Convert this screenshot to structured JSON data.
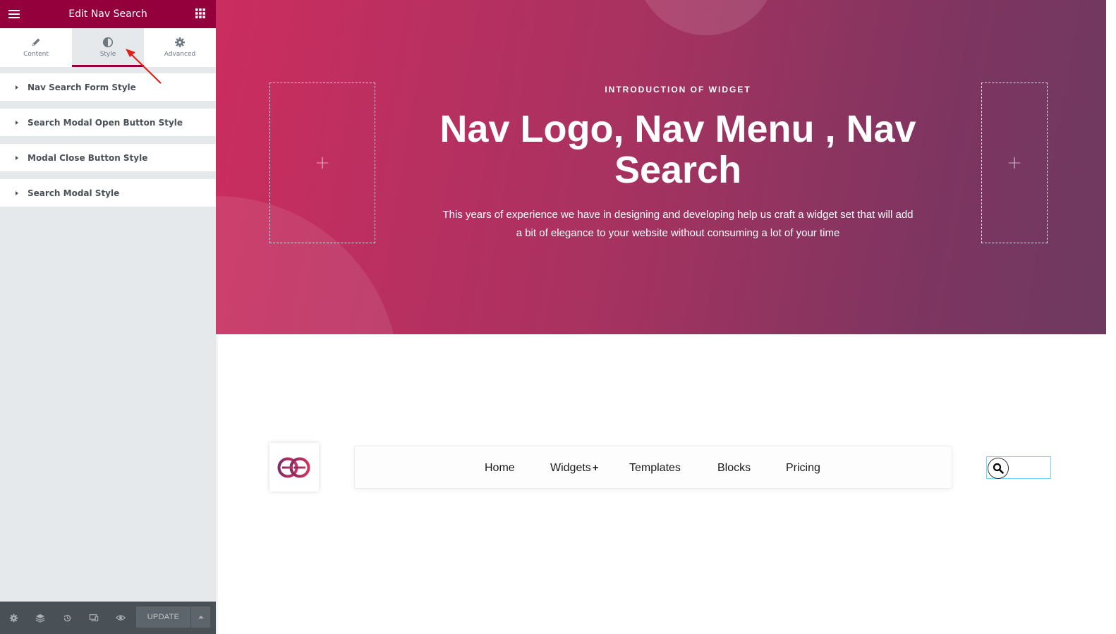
{
  "panel": {
    "title": "Edit Nav Search",
    "tabs": [
      {
        "label": "Content",
        "icon": "pencil-icon"
      },
      {
        "label": "Style",
        "icon": "half-circle-icon",
        "active": true
      },
      {
        "label": "Advanced",
        "icon": "gear-icon"
      }
    ],
    "sections": [
      {
        "label": "Nav Search Form Style"
      },
      {
        "label": "Search Modal Open Button Style"
      },
      {
        "label": "Modal Close Button Style"
      },
      {
        "label": "Search Modal Style"
      }
    ],
    "footer": {
      "update_label": "UPDATE",
      "icons": [
        "settings-icon",
        "layers-icon",
        "history-icon",
        "responsive-icon",
        "preview-eye-icon"
      ]
    }
  },
  "hero": {
    "eyebrow": "INTRODUCTION OF WIDGET",
    "title": "Nav Logo, Nav Menu , Nav Search",
    "description": "This years of experience we have in designing and developing help us craft a widget set that will add a bit of elegance to your website without consuming a lot of your time",
    "add_symbol": "+"
  },
  "nav": {
    "items": [
      {
        "label": "Home"
      },
      {
        "label": "Widgets",
        "has_submenu": true,
        "submenu_indicator": "+"
      },
      {
        "label": "Templates"
      },
      {
        "label": "Blocks"
      },
      {
        "label": "Pricing"
      }
    ]
  },
  "colors": {
    "brand": "#93003c",
    "panel_bg": "#e6e9ec",
    "footer_bg": "#495157",
    "hero_start": "#cb2d5f",
    "hero_end": "#6e3a60",
    "search_border": "#71d7f7",
    "annotation": "#e0201b"
  }
}
